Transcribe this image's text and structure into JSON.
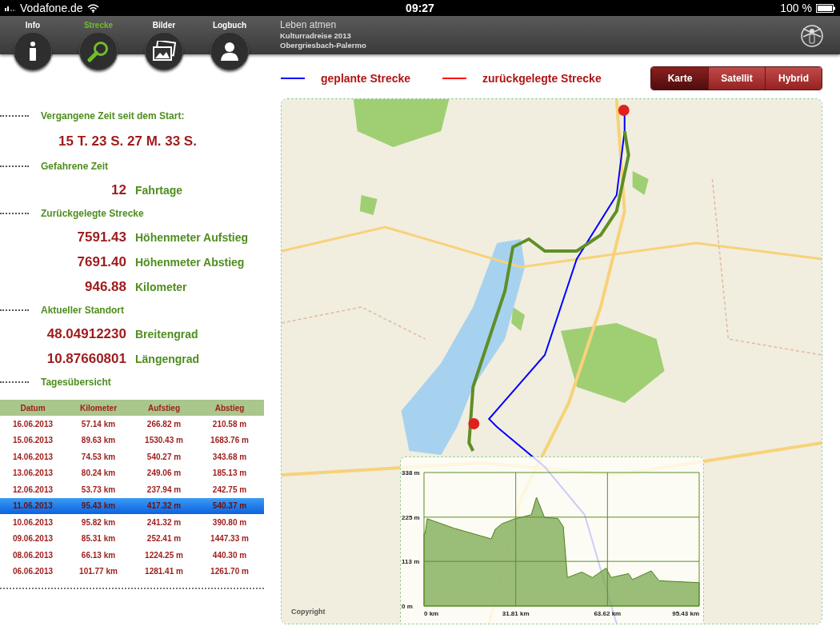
{
  "status_bar": {
    "carrier": "Vodafone.de",
    "time": "09:27",
    "battery": "100 %"
  },
  "nav": {
    "tabs": [
      {
        "label": "Info",
        "kind": "info",
        "selected": false
      },
      {
        "label": "Strecke",
        "kind": "search",
        "selected": true
      },
      {
        "label": "Bilder",
        "kind": "pictures",
        "selected": false
      },
      {
        "label": "Logbuch",
        "kind": "person",
        "selected": false
      }
    ],
    "title": "Leben atmen",
    "subtitle": "Kulturradreise 2013",
    "route": "Obergriesbach-Palermo"
  },
  "legend": [
    {
      "label": "geplante Strecke",
      "color": "#0000ff"
    },
    {
      "label": "zurückgelegte Strecke",
      "color": "#ff0000"
    }
  ],
  "map_types": [
    {
      "label": "Karte",
      "selected": true
    },
    {
      "label": "Satellit",
      "selected": false
    },
    {
      "label": "Hybrid",
      "selected": false
    }
  ],
  "stats": [
    {
      "heading": "Vergangene Zeit seit dem Start:",
      "rows": [
        {
          "kind": "full",
          "value": "15 T. 23 S. 27 M. 33 S."
        }
      ]
    },
    {
      "heading": "Gefahrene Zeit",
      "rows": [
        {
          "kind": "pair",
          "value": "12",
          "label": "Fahrtage"
        }
      ]
    },
    {
      "heading": "Zurückgelegte Strecke",
      "rows": [
        {
          "kind": "pair",
          "value": "7591.43",
          "label": "Höhenmeter Aufstieg"
        },
        {
          "kind": "pair",
          "value": "7691.40",
          "label": "Höhenmeter Abstieg"
        },
        {
          "kind": "pair",
          "value": "946.88",
          "label": "Kilometer"
        }
      ]
    },
    {
      "heading": "Aktueller Standort",
      "rows": [
        {
          "kind": "pair",
          "value": "48.04912230",
          "label": "Breitengrad"
        },
        {
          "kind": "pair",
          "value": "10.87660801",
          "label": "Längengrad"
        }
      ]
    }
  ],
  "daily_table": {
    "heading": "Tagesübersicht",
    "columns": [
      "Datum",
      "Kilometer",
      "Aufstieg",
      "Abstieg"
    ],
    "rows": [
      {
        "cells": [
          "16.06.2013",
          "57.14 km",
          "266.82 m",
          "210.58 m"
        ],
        "selected": false
      },
      {
        "cells": [
          "15.06.2013",
          "89.63 km",
          "1530.43 m",
          "1683.76 m"
        ],
        "selected": false
      },
      {
        "cells": [
          "14.06.2013",
          "74.53 km",
          "540.27 m",
          "343.68 m"
        ],
        "selected": false
      },
      {
        "cells": [
          "13.06.2013",
          "80.24 km",
          "249.06 m",
          "185.13 m"
        ],
        "selected": false
      },
      {
        "cells": [
          "12.06.2013",
          "53.73 km",
          "237.94 m",
          "242.75 m"
        ],
        "selected": false
      },
      {
        "cells": [
          "11.06.2013",
          "95.43 km",
          "417.32 m",
          "540.37 m"
        ],
        "selected": true
      },
      {
        "cells": [
          "10.06.2013",
          "95.82 km",
          "241.32 m",
          "390.80 m"
        ],
        "selected": false
      },
      {
        "cells": [
          "09.06.2013",
          "85.31 km",
          "252.41 m",
          "1447.33 m"
        ],
        "selected": false
      },
      {
        "cells": [
          "08.06.2013",
          "66.13 km",
          "1224.25 m",
          "440.30 m"
        ],
        "selected": false
      },
      {
        "cells": [
          "06.06.2013",
          "101.77 km",
          "1281.41 m",
          "1261.70 m"
        ],
        "selected": false
      }
    ]
  },
  "map": {
    "kind": "picture",
    "attribution": "Copyright",
    "elevation": {
      "chart_data": {
        "type": "area",
        "x": [
          0,
          0.4,
          1.1,
          10.4,
          23.3,
          24.7,
          27,
          31.6,
          37.2,
          39,
          41.8,
          46.4,
          48.3,
          49.7,
          54.7,
          58.4,
          63.1,
          64.9,
          70.9,
          72.3,
          78.8,
          81.5,
          95.43
        ],
        "grid": true,
        "series": [
          {
            "color": "#7aa84e",
            "values": [
              184,
              184,
              221,
              197,
              170,
              194,
              208,
              221,
              231,
              275,
              224,
              222,
              201,
              72,
              86,
              72,
              96,
              72,
              82,
              67,
              89,
              64,
              59
            ]
          }
        ],
        "xlim": [
          0,
          95.43
        ],
        "ylim": [
          0,
          338
        ],
        "xticks": [
          {
            "value": 0,
            "label": "0 km"
          },
          {
            "value": 31.81,
            "label": "31.81 km"
          },
          {
            "value": 63.62,
            "label": "63.62 km"
          },
          {
            "value": 95.43,
            "label": "95.43 km"
          }
        ],
        "yticks": [
          {
            "value": 0,
            "label": "0 m"
          },
          {
            "value": 113,
            "label": "113 m"
          },
          {
            "value": 225,
            "label": "225 m"
          },
          {
            "value": 338,
            "label": "338 m"
          }
        ]
      }
    }
  }
}
